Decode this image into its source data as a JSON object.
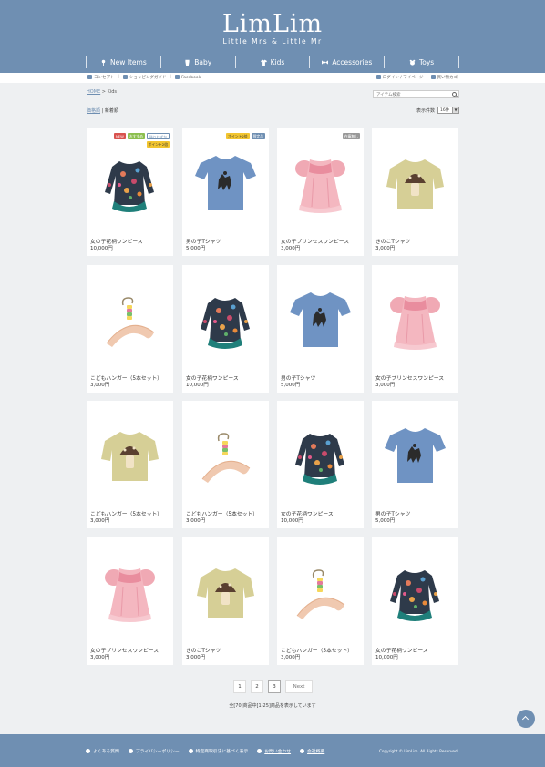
{
  "logo": {
    "main": "LimLim",
    "sub": "Little Mrs & Little Mr"
  },
  "nav": [
    {
      "label": "New Items",
      "icon": "pin-icon"
    },
    {
      "label": "Baby",
      "icon": "baby-icon"
    },
    {
      "label": "Kids",
      "icon": "shirt-icon"
    },
    {
      "label": "Accessories",
      "icon": "ribbon-icon"
    },
    {
      "label": "Toys",
      "icon": "toy-icon"
    }
  ],
  "util": {
    "left": [
      "コンセプト",
      "ショッピングガイド",
      "Facebook"
    ],
    "login": "ログイン / マイページ",
    "cart": "買い物カゴ"
  },
  "breadcrumb": {
    "home": "HOME",
    "sep": " > ",
    "current": "Kids"
  },
  "search": {
    "placeholder": "アイテム検索"
  },
  "sort": {
    "link": "価格順",
    "sep": " | ",
    "current": "新着順"
  },
  "count": {
    "label": "表示件数",
    "value": "16件"
  },
  "products": [
    {
      "name": "女の子花柄ワンピース",
      "price": "10,000円",
      "img": "dress",
      "badges": [
        {
          "t": "NEW",
          "c": "#d9534f"
        },
        {
          "t": "おすすめ",
          "c": "#8cbf4f"
        },
        {
          "t": "残りわずか",
          "c": "#ffffff",
          "tc": "#6f8fb2",
          "b": "#6f8fb2"
        },
        {
          "t": "ポイント2倍",
          "c": "#f2c530",
          "tc": "#333"
        }
      ]
    },
    {
      "name": "男の子Tシャツ",
      "price": "5,000円",
      "img": "tshirt",
      "badges": [
        {
          "t": "ポイント2倍",
          "c": "#f2c530",
          "tc": "#333"
        },
        {
          "t": "限定品",
          "c": "#6f8fb2"
        }
      ]
    },
    {
      "name": "女の子プリンセスワンピース",
      "price": "3,000円",
      "img": "pink",
      "badges": [
        {
          "t": "在庫無し",
          "c": "#999999"
        }
      ]
    },
    {
      "name": "きのこTシャツ",
      "price": "3,000円",
      "img": "mushroom",
      "badges": []
    },
    {
      "name": "こどもハンガー（5本セット）",
      "price": "3,000円",
      "img": "hanger",
      "badges": []
    },
    {
      "name": "女の子花柄ワンピース",
      "price": "10,000円",
      "img": "dress",
      "badges": []
    },
    {
      "name": "男の子Tシャツ",
      "price": "5,000円",
      "img": "tshirt",
      "badges": []
    },
    {
      "name": "女の子プリンセスワンピース",
      "price": "3,000円",
      "img": "pink",
      "badges": []
    },
    {
      "name": "こどもハンガー（5本セット）",
      "price": "3,000円",
      "img": "mushroom",
      "badges": []
    },
    {
      "name": "こどもハンガー（5本セット）",
      "price": "3,000円",
      "img": "hanger",
      "badges": []
    },
    {
      "name": "女の子花柄ワンピース",
      "price": "10,000円",
      "img": "dress",
      "badges": []
    },
    {
      "name": "男の子Tシャツ",
      "price": "5,000円",
      "img": "tshirt",
      "badges": []
    },
    {
      "name": "女の子プリンセスワンピース",
      "price": "3,000円",
      "img": "pink",
      "badges": []
    },
    {
      "name": "きのこTシャツ",
      "price": "3,000円",
      "img": "mushroom",
      "badges": []
    },
    {
      "name": "こどもハンガー（5本セット）",
      "price": "3,000円",
      "img": "hanger",
      "badges": []
    },
    {
      "name": "女の子花柄ワンピース",
      "price": "10,000円",
      "img": "dress",
      "badges": []
    }
  ],
  "pagination": {
    "pages": [
      "1",
      "2",
      "3"
    ],
    "current": "3",
    "next": "Next"
  },
  "result": "全[70]商品中[1-25]商品を表示しています",
  "footer": {
    "links": [
      "よくある質問",
      "プライバシーポリシー",
      "特定商取引法に基づく表示",
      "お問い合わせ",
      "会社概要"
    ],
    "copyright": "Copyright © LimLim. All Rights Reserved."
  },
  "colors": {
    "brand": "#6f8fb2",
    "bg": "#eef0f2"
  }
}
